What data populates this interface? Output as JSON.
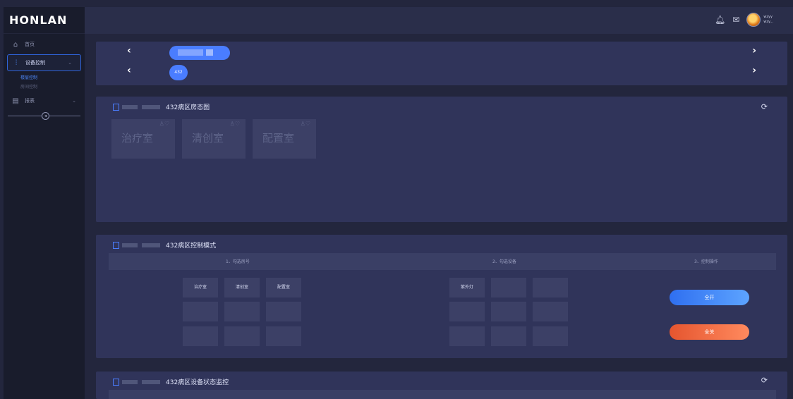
{
  "app": {
    "logo_text": "HONLAN"
  },
  "sidebar": {
    "items": [
      {
        "label": "首页",
        "icon": "home-icon"
      },
      {
        "label": "设备控制",
        "icon": "sliders-icon",
        "chevron": "⌄"
      },
      {
        "label": "报表",
        "icon": "report-icon",
        "chevron": "⌄"
      }
    ],
    "sub_items": [
      {
        "label": "楼层控制",
        "active": true
      },
      {
        "label": "房间控制",
        "active": false
      }
    ],
    "collapse_glyph": "◂"
  },
  "header": {
    "icons": [
      "bell-icon",
      "message-icon"
    ],
    "user": {
      "line1": "wzyy",
      "line2": "wzy..."
    }
  },
  "top_panel": {
    "arrow_left": "‹",
    "arrow_right": "›",
    "ward_badge": "432"
  },
  "room_panel": {
    "title": "432病区房态图",
    "rooms": [
      "治疗室",
      "清创室",
      "配置室"
    ],
    "room_icons": "♙♡",
    "refresh_glyph": "⟳"
  },
  "control_panel": {
    "title": "432病区控制模式",
    "steps": [
      "1、勾选房号",
      "2、勾选设备",
      "3、控制操作"
    ],
    "room_checks": [
      "治疗室",
      "清创室",
      "配置室"
    ],
    "device_checks": [
      "紫外灯"
    ],
    "btn_all_on": "全开",
    "btn_all_off": "全关"
  },
  "monitor_panel": {
    "title": "432病区设备状态监控",
    "refresh_glyph": "⟳"
  },
  "colors": {
    "accent": "#4a7dff",
    "danger": "#e5552f",
    "panel": "#30345a",
    "bg": "#23263d"
  }
}
